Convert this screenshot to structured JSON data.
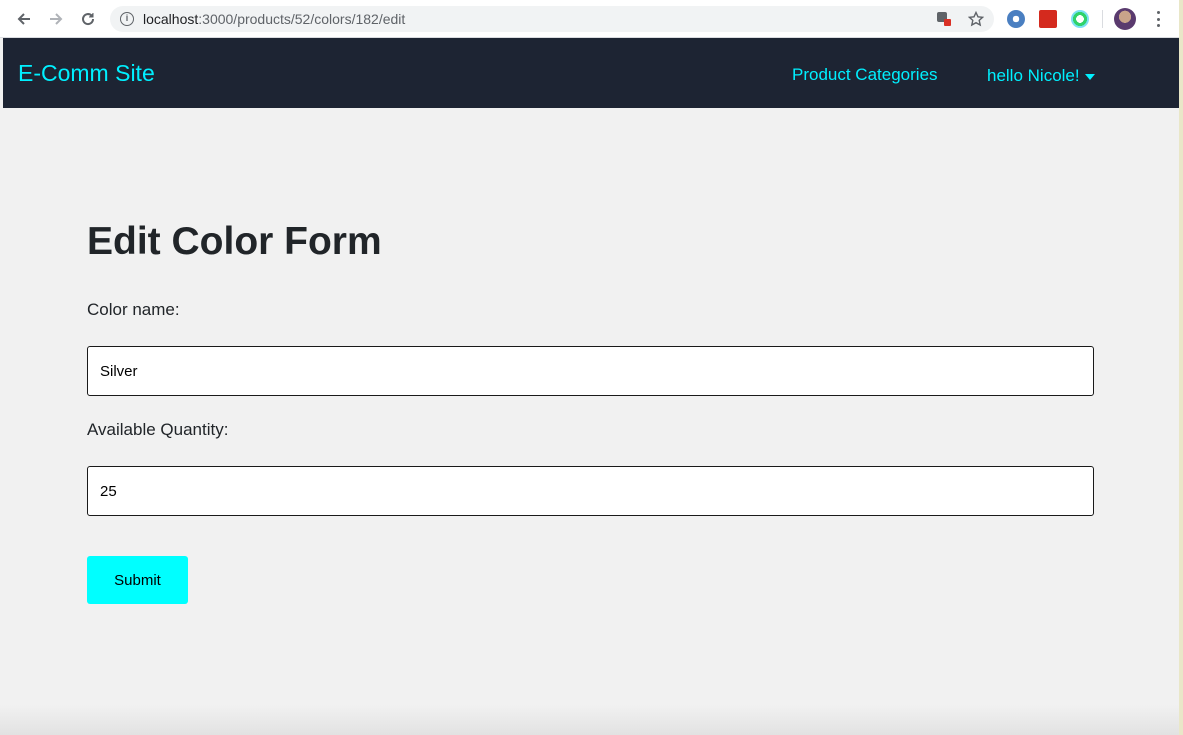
{
  "browser": {
    "url_host": "localhost",
    "url_path": ":3000/products/52/colors/182/edit"
  },
  "navbar": {
    "brand": "E-Comm Site",
    "links": [
      "Product Categories"
    ],
    "user_greeting": "hello Nicole!"
  },
  "form": {
    "title": "Edit Color Form",
    "color_name_label": "Color name:",
    "color_name_value": "Silver",
    "quantity_label": "Available Quantity:",
    "quantity_value": "25",
    "submit_label": "Submit"
  },
  "colors": {
    "navbar_bg": "#1d2433",
    "accent": "#00f0ff",
    "button_bg": "#00ffff",
    "page_bg": "#f1f1f1"
  }
}
